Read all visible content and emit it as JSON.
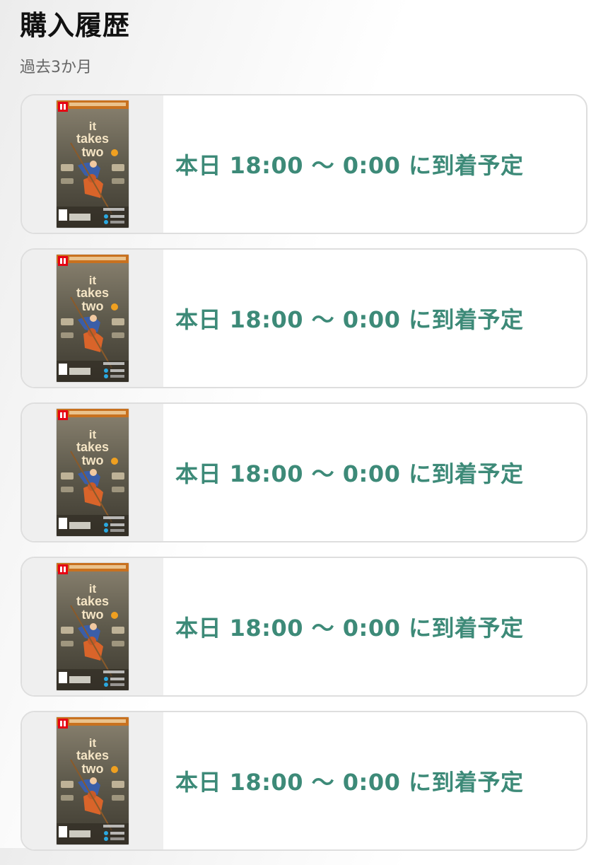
{
  "header": {
    "title": "購入履歴",
    "period": "過去3か月"
  },
  "orders": [
    {
      "product_icon": "game-box-art",
      "cover_title_lines": [
        "it",
        "takes",
        "two"
      ],
      "delivery": "本日 18:00 〜 0:00 に到着予定"
    },
    {
      "product_icon": "game-box-art",
      "cover_title_lines": [
        "it",
        "takes",
        "two"
      ],
      "delivery": "本日 18:00 〜 0:00 に到着予定"
    },
    {
      "product_icon": "game-box-art",
      "cover_title_lines": [
        "it",
        "takes",
        "two"
      ],
      "delivery": "本日 18:00 〜 0:00 に到着予定"
    },
    {
      "product_icon": "game-box-art",
      "cover_title_lines": [
        "it",
        "takes",
        "two"
      ],
      "delivery": "本日 18:00 〜 0:00 に到着予定"
    },
    {
      "product_icon": "game-box-art",
      "cover_title_lines": [
        "it",
        "takes",
        "two"
      ],
      "delivery": "本日 18:00 〜 0:00 に到着予定"
    }
  ],
  "colors": {
    "delivery_text": "#3d8a78",
    "card_border": "#dedede",
    "thumb_background": "#efefef",
    "switch_red": "#e60012"
  }
}
